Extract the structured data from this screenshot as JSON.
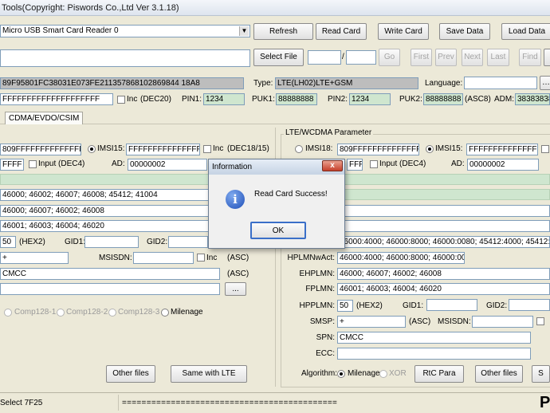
{
  "window": {
    "title": "Tools(Copyright: Piswords Co.,Ltd Ver 3.1.18)"
  },
  "toolbar": {
    "reader_select": "Micro USB Smart Card Reader 0",
    "refresh": "Refresh",
    "read_card": "Read Card",
    "write_card": "Write Card",
    "save_data": "Save Data",
    "load_data": "Load Data",
    "select_file": "Select File",
    "page_sep": "/",
    "go": "Go",
    "first": "First",
    "prev": "Prev",
    "next": "Next",
    "last": "Last",
    "find": "Find"
  },
  "card_info": {
    "iccid": "89F95801FC38031E073FE211357868102869844 18A8",
    "type_label": "Type:",
    "type_value": "LTE(LH02)LTE+GSM",
    "language_label": "Language:",
    "ki": "FFFFFFFFFFFFFFFFFFFF",
    "inc_label": "Inc",
    "dec_label": "(DEC20)",
    "pin1_label": "PIN1:",
    "pin1": "1234",
    "puk1_label": "PUK1:",
    "puk1": "88888888",
    "pin2_label": "PIN2:",
    "pin2": "1234",
    "puk2_label": "PUK2:",
    "puk2": "88888888",
    "asc8": "(ASC8)",
    "adm_label": "ADM:",
    "adm": "38383838"
  },
  "tabs": {
    "cdma": "CDMA/EVDO/CSIM"
  },
  "left": {
    "imsi18": "809FFFFFFFFFFFFFF",
    "imsi15_label": "IMSI15:",
    "imsi15": "FFFFFFFFFFFFFFF",
    "inc_label": "Inc",
    "inc_dec": "(DEC18/15)",
    "acc": "FFFF",
    "input_label": "Input (DEC4)",
    "ad_label": "AD:",
    "ad": "00000002",
    "row1": "46000; 46002; 46007; 46008; 45412; 41004",
    "row2": "46000; 46007; 46002; 46008",
    "row3": "46001; 46003; 46004; 46020",
    "hpplmn": "50",
    "hex2": "(HEX2)",
    "gid1_label": "GID1:",
    "gid2_label": "GID2:",
    "smsp": "+",
    "msisdn_label": "MSISDN:",
    "inc2": "Inc",
    "asc": "(ASC)",
    "spn": "CMCC",
    "asc2": "(ASC)",
    "browse": "...",
    "comp1": "Comp128-1",
    "comp2": "Comp128-2",
    "comp3": "Comp128-3",
    "milenage": "Milenage",
    "other_files": "Other files",
    "same_lte": "Same with LTE"
  },
  "right": {
    "group_title": "LTE/WCDMA Parameter",
    "imsi18_label": "IMSI18:",
    "imsi18": "809FFFFFFFFFFFFFFF",
    "imsi15_label": "IMSI15:",
    "imsi15": "FFFFFFFFFFFFFFF",
    "acc": "FFFF",
    "input_label": "Input (DEC4)",
    "ad_label": "AD:",
    "ad": "00000002",
    "oplmn_row": "46000:4000; 46000:8000; 46000:0080; 45412:4000; 45412:8000; 4",
    "hplmnwact_label": "HPLMNwAct:",
    "hplmnwact": "46000:4000; 46000:8000; 46000:0080",
    "ehplmn_label": "EHPLMN:",
    "ehplmn": "46000; 46007; 46002; 46008",
    "fplmn_label": "FPLMN:",
    "fplmn": "46001; 46003; 46004; 46020",
    "hpplmn_label": "HPPLMN:",
    "hpplmn": "50",
    "hex2": "(HEX2)",
    "gid1_label": "GID1:",
    "gid2_label": "GID2:",
    "smsp_label": "SMSP:",
    "smsp": "+",
    "asc": "(ASC)",
    "msisdn_label": "MSISDN:",
    "spn_label": "SPN:",
    "spn": "CMCC",
    "ecc_label": "ECC:",
    "algorithm_label": "Algorithm:",
    "milenage": "Milenage",
    "xor": "XOR",
    "rc_para": "RtC Para",
    "other_files": "Other files",
    "save": "S"
  },
  "dialog": {
    "title": "Information",
    "close": "x",
    "message": "Read Card Success!",
    "ok": "OK"
  },
  "status": {
    "text": "Select 7F25",
    "progress": "============================================",
    "logo": "P"
  }
}
